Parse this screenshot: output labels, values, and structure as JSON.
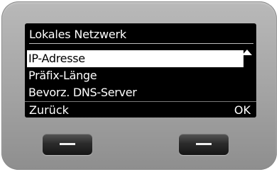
{
  "screen": {
    "title": "Lokales Netzwerk",
    "menu_items": [
      {
        "label": "IP-Adresse",
        "selected": true
      },
      {
        "label": "Präfix-Länge",
        "selected": false
      },
      {
        "label": "Bevorz. DNS-Server",
        "selected": false
      }
    ],
    "softkeys": {
      "left_label": "Zurück",
      "right_label": "OK"
    }
  },
  "icons": {
    "scroll_up": "scroll-up-arrow-icon",
    "scroll_down": "scroll-down-arrow-icon",
    "hardware_button_mark": "dash-icon"
  },
  "colors": {
    "screen_bg": "#000000",
    "text": "#ffffff",
    "highlight_bg": "#ffffff",
    "highlight_text": "#000000",
    "device_body": "#a8a8a8"
  }
}
